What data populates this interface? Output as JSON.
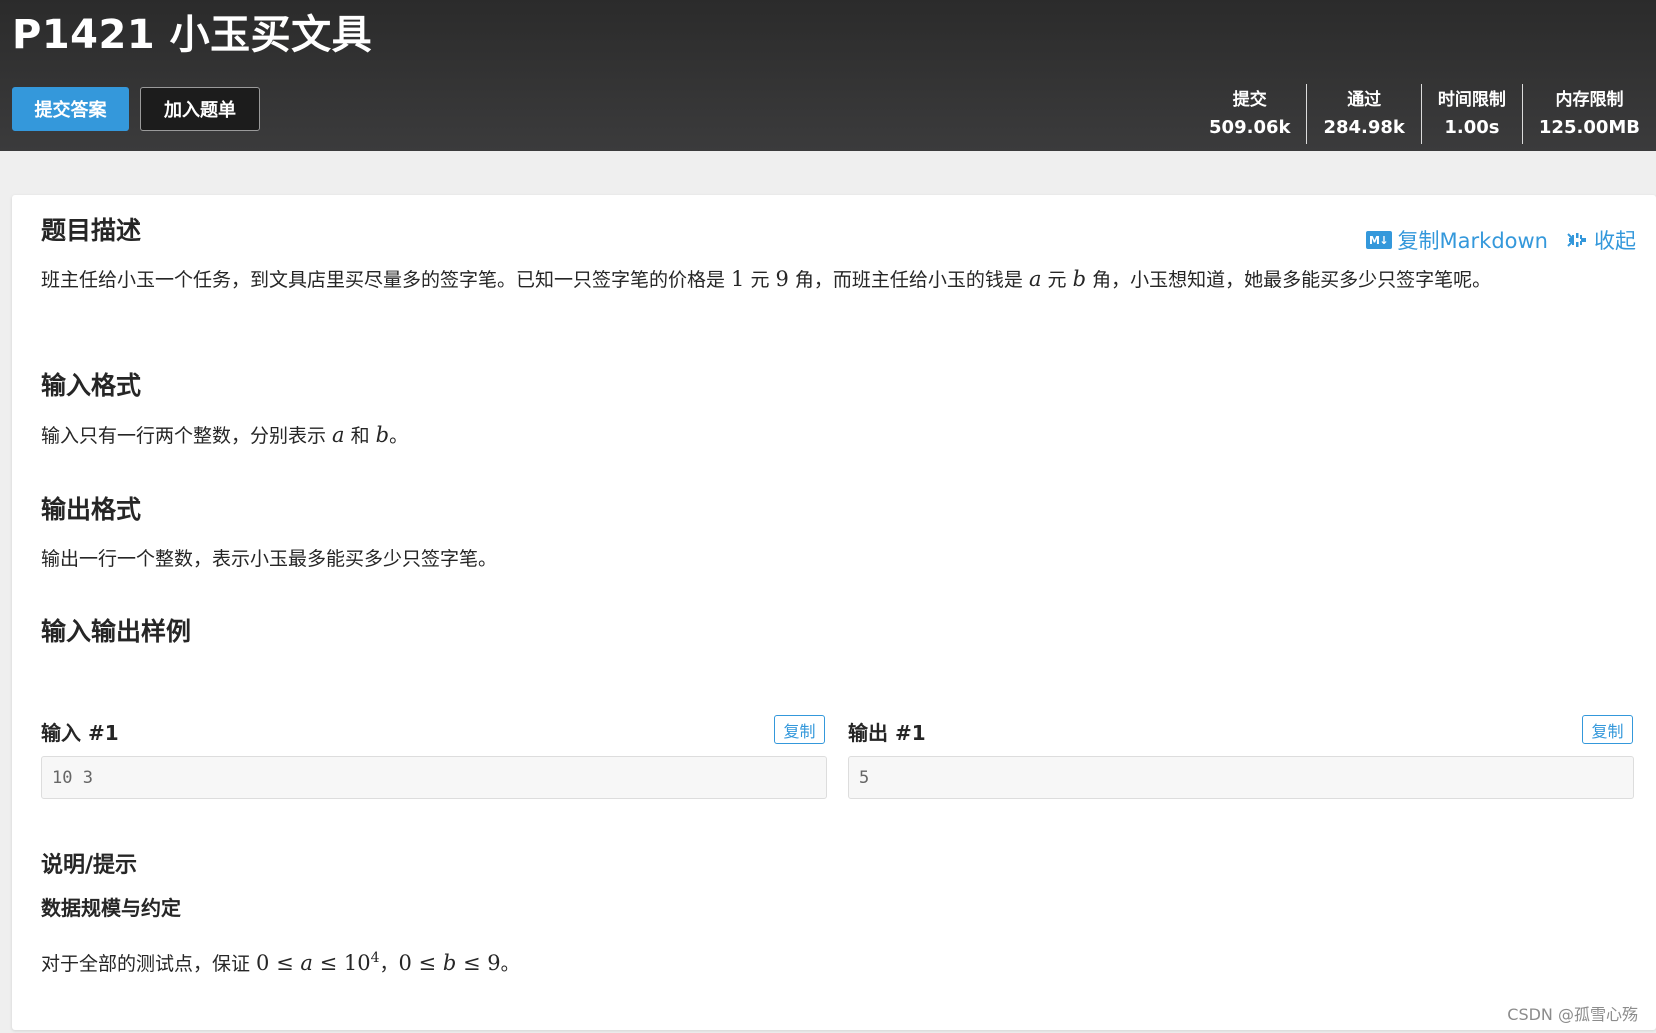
{
  "header": {
    "title": "P1421 小玉买文具",
    "buttons": {
      "submit": "提交答案",
      "add_to_list": "加入题单"
    },
    "stats": [
      {
        "label": "提交",
        "value": "509.06k"
      },
      {
        "label": "通过",
        "value": "284.98k"
      },
      {
        "label": "时间限制",
        "value": "1.00s"
      },
      {
        "label": "内存限制",
        "value": "125.00MB"
      }
    ]
  },
  "toolbar": {
    "md_badge": "M↓",
    "copy_markdown": "复制Markdown",
    "collapse": "收起"
  },
  "description": {
    "heading": "题目描述",
    "t1": "班主任给小玉一个任务，到文具店里买尽量多的签字笔。已知一只签字笔的价格是 ",
    "m1": "1",
    "t2": " 元 ",
    "m2": "9",
    "t3": " 角，而班主任给小玉的钱是 ",
    "m3": "a",
    "t4": " 元 ",
    "m4": "b",
    "t5": " 角，小玉想知道，她最多能买多少只签字笔呢。"
  },
  "input_format": {
    "heading": "输入格式",
    "t1": "输入只有一行两个整数，分别表示 ",
    "m1": "a",
    "t2": " 和 ",
    "m2": "b",
    "t3": "。"
  },
  "output_format": {
    "heading": "输出格式",
    "text": "输出一行一个整数，表示小玉最多能买多少只签字笔。"
  },
  "samples": {
    "heading": "输入输出样例",
    "input_label": "输入 #1",
    "output_label": "输出 #1",
    "copy_label": "复制",
    "input_value": "10 3",
    "output_value": "5"
  },
  "hint": {
    "heading": "说明/提示",
    "subheading": "数据规模与约定",
    "t1": "对于全部的测试点，保证 ",
    "m_a1": "0 ≤ ",
    "m_a2": "a",
    "m_a3": " ≤ 10",
    "m_a4": "4",
    "t2": "，",
    "m_b1": "0 ≤ ",
    "m_b2": "b",
    "m_b3": " ≤ 9",
    "t3": "。"
  },
  "watermark": "CSDN @孤雪心殇",
  "colors": {
    "accent": "#3498db",
    "header_bg": "#2b2b2b",
    "page_bg": "#efefef"
  }
}
